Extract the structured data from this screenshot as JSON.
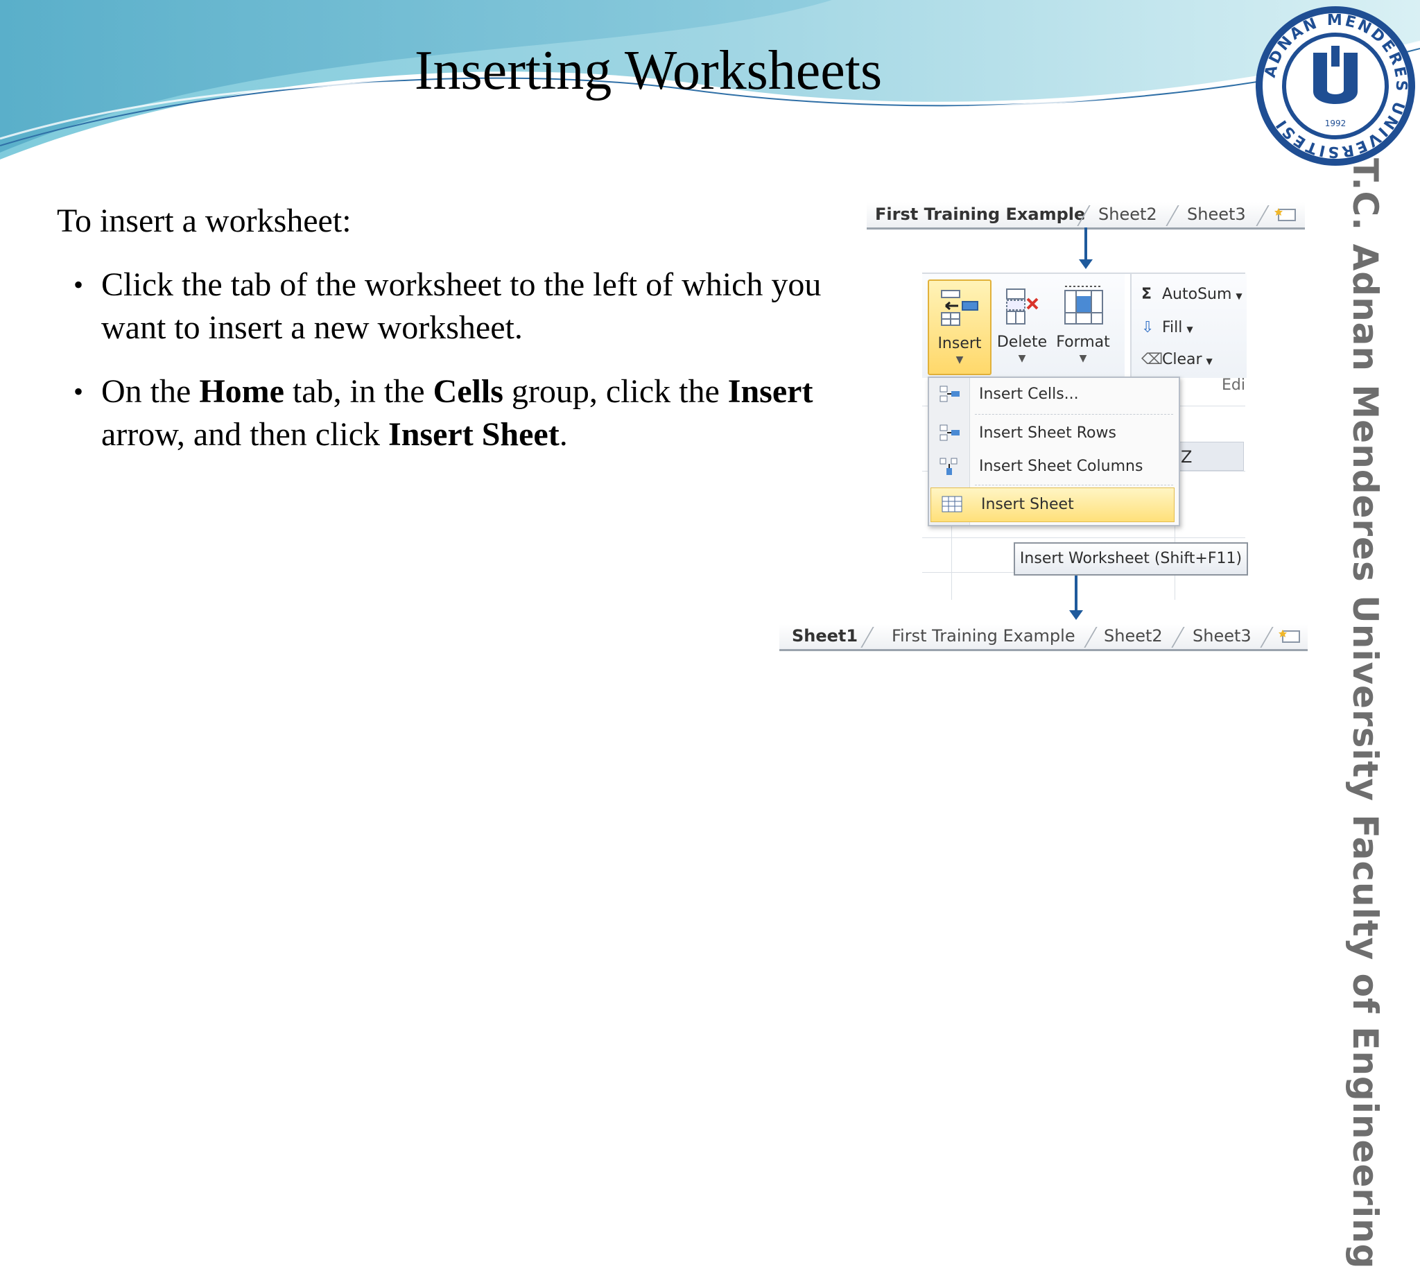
{
  "slide": {
    "title": "Inserting Worksheets",
    "intro": "To insert a worksheet:",
    "bullets": [
      {
        "text_plain_1": "Click the tab of the worksheet to the left of which you want to insert a new worksheet."
      },
      {
        "p1": "On the ",
        "b1": "Home",
        "p2": " tab, in the ",
        "b2": "Cells",
        "p3": " group, click the ",
        "b3": "Insert",
        "p4": " arrow, and then click ",
        "b4": "Insert Sheet",
        "p5": "."
      }
    ],
    "sidebar_text": "T.C.   Adnan Menderes University   Faculty of Engineering",
    "seal_text": "ADNAN MENDERES ÜNİVERSİTESİ",
    "seal_year": "1992"
  },
  "top_tabs": [
    "First Training Example",
    "Sheet2",
    "Sheet3"
  ],
  "bottom_tabs": [
    "Sheet1",
    "First Training Example",
    "Sheet2",
    "Sheet3"
  ],
  "ribbon": {
    "insert_label": "Insert",
    "delete_label": "Delete",
    "format_label": "Format",
    "autosum_label": "AutoSum",
    "fill_label": "Fill",
    "clear_label": "Clear",
    "group_label_partial": "Edi",
    "column_header": "Z"
  },
  "menu": {
    "items": [
      "Insert Cells...",
      "Insert Sheet Rows",
      "Insert Sheet Columns",
      "Insert Sheet"
    ]
  },
  "tooltip": "Insert Worksheet (Shift+F11)",
  "colors": {
    "accent_blue": "#1f5a9c",
    "highlight_yellow": "#ffe07a",
    "header_teal": "#5bb6cf"
  }
}
